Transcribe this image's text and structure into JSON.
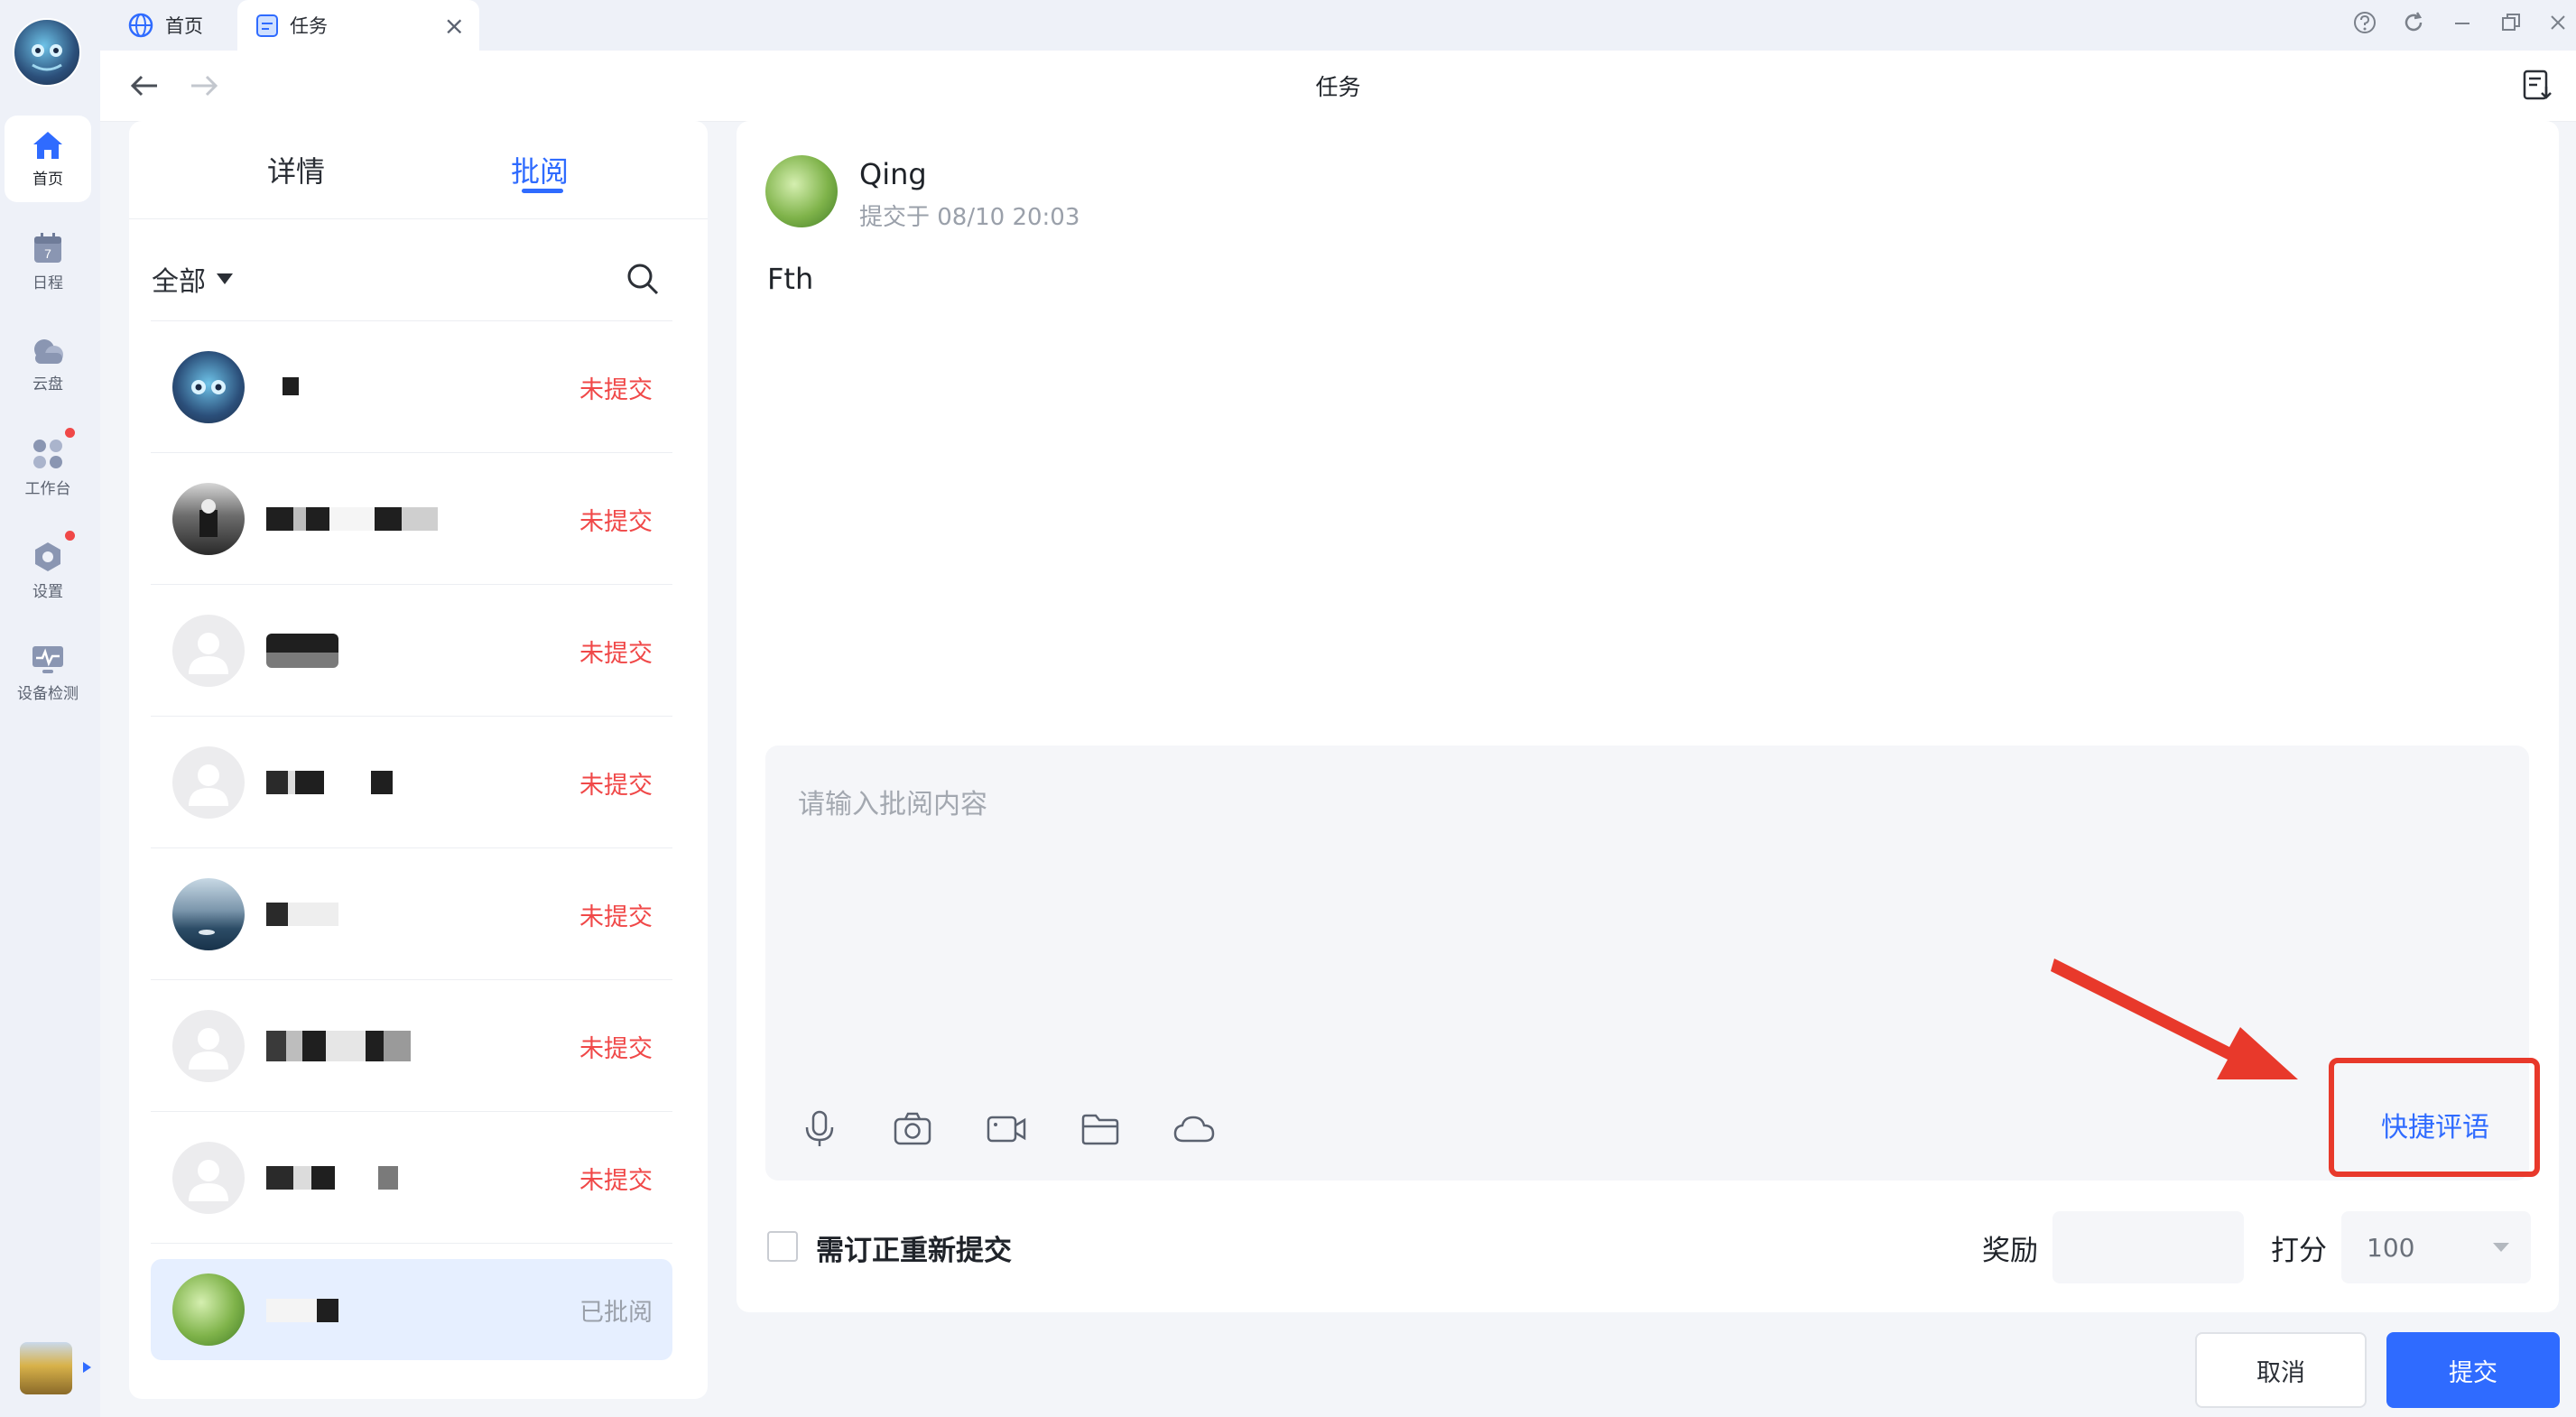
{
  "titlebar": {
    "tabs": [
      {
        "label": "首页",
        "icon": "globe-icon"
      },
      {
        "label": "任务",
        "icon": "task-icon"
      }
    ],
    "tab_close": "×"
  },
  "navbar": {
    "title": "任务"
  },
  "rail": {
    "items": [
      {
        "label": "首页",
        "icon": "home-icon",
        "active": true
      },
      {
        "label": "日程",
        "icon": "calendar-icon",
        "badge_text": "7"
      },
      {
        "label": "云盘",
        "icon": "cloud-drive-icon"
      },
      {
        "label": "工作台",
        "icon": "workbench-icon",
        "has_dot": true
      },
      {
        "label": "设置",
        "icon": "settings-icon",
        "has_dot": true
      },
      {
        "label": "设备检测",
        "icon": "device-check-icon"
      }
    ]
  },
  "left_panel": {
    "tabs": [
      {
        "label": "详情",
        "active": false
      },
      {
        "label": "批阅",
        "active": true
      }
    ],
    "filter": {
      "label": "全部"
    },
    "list": [
      {
        "status": "未提交",
        "avatar": "anime-avatar"
      },
      {
        "status": "未提交",
        "avatar": "photo-avatar"
      },
      {
        "status": "未提交",
        "avatar": "default-avatar"
      },
      {
        "status": "未提交",
        "avatar": "default-avatar"
      },
      {
        "status": "未提交",
        "avatar": "lake-avatar"
      },
      {
        "status": "未提交",
        "avatar": "default-avatar"
      },
      {
        "status": "未提交",
        "avatar": "default-avatar"
      },
      {
        "status": "已批阅",
        "avatar": "grass-avatar",
        "selected": true
      }
    ]
  },
  "submission": {
    "author": "Qing",
    "submitted_at": "提交于 08/10 20:03",
    "content": "Fth"
  },
  "review_box": {
    "placeholder": "请输入批阅内容",
    "quick_comment_label": "快捷评语",
    "tools": [
      "microphone-icon",
      "camera-icon",
      "video-icon",
      "folder-icon",
      "cloud-icon"
    ]
  },
  "footer_options": {
    "revise_label": "需订正重新提交",
    "reward_label": "奖励",
    "reward_value": "",
    "score_label": "打分",
    "score_value": "100"
  },
  "actions": {
    "cancel": "取消",
    "submit": "提交"
  },
  "colors": {
    "accent": "#2f6bff",
    "danger": "#f04848",
    "highlight_box": "#e8392b"
  }
}
